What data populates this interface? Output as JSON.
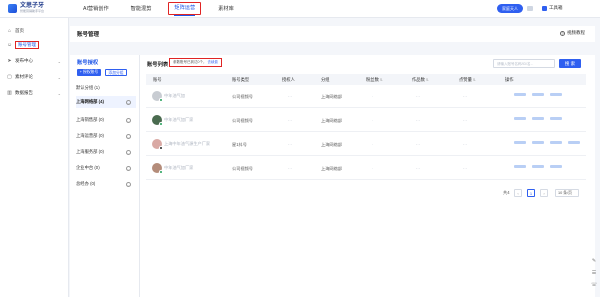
{
  "brand": {
    "name": "文思子牙",
    "tagline": "智能营销助手平台"
  },
  "top_nav": [
    {
      "label": "AI营销创作",
      "active": false
    },
    {
      "label": "智能混剪",
      "active": false
    },
    {
      "label": "矩阵运营",
      "active": true
    },
    {
      "label": "素材库",
      "active": false
    }
  ],
  "header": {
    "user_badge": "家庭天人",
    "workbench_label": "工具箱"
  },
  "sidebar": {
    "items": [
      {
        "label": "首页",
        "icon": "home-icon",
        "active": false,
        "has_chevron": false
      },
      {
        "label": "账号管理",
        "icon": "user-icon",
        "active": true,
        "has_chevron": false
      },
      {
        "label": "发布中心",
        "icon": "send-icon",
        "active": false,
        "has_chevron": true
      },
      {
        "label": "素材评论",
        "icon": "comment-icon",
        "active": false,
        "has_chevron": true
      },
      {
        "label": "数据报告",
        "icon": "chart-icon",
        "active": false,
        "has_chevron": true
      }
    ]
  },
  "page": {
    "title": "账号管理",
    "help_label": "视频教程"
  },
  "groups": {
    "title": "账号授权",
    "add_label": "+ 授权账号",
    "sort_label": "添加分组",
    "items": [
      {
        "label": "默认分组 (1)",
        "selected": false,
        "has_more": false
      },
      {
        "label": "上海网络部 (4)",
        "selected": true,
        "has_more": true
      },
      {
        "label": "上海销售部 (0)",
        "selected": false,
        "has_more": true
      },
      {
        "label": "上海运营部 (0)",
        "selected": false,
        "has_more": true
      },
      {
        "label": "上海服务部 (0)",
        "selected": false,
        "has_more": true
      },
      {
        "label": "企业中台 (0)",
        "selected": false,
        "has_more": true
      },
      {
        "label": "总经办 (0)",
        "selected": false,
        "has_more": true
      }
    ]
  },
  "table": {
    "title": "账号列表",
    "warning_text": "参数账号已到达0个，",
    "warning_link": "去续费",
    "search_placeholder": "请输入账号名称/ID/名...",
    "search_button": "搜 索",
    "columns": [
      "账号",
      "账号类型",
      "授权人",
      "分组",
      "粉丝数",
      "作品数",
      "点赞量",
      "操作"
    ],
    "rows": [
      {
        "account": "中年油气加",
        "type": "公司视频号",
        "authorizer": "- -",
        "group": "上海网络部",
        "fans": "·",
        "works": "- -",
        "likes": "- -"
      },
      {
        "account": "中年油气加厂家",
        "type": "公司视频号",
        "authorizer": "- -",
        "group": "上海网络部",
        "fans": "·",
        "works": "- -",
        "likes": "- -"
      },
      {
        "account": "上海中年油气源生产厂家",
        "type": "星1抖号",
        "authorizer": "- -",
        "group": "上海网络部",
        "fans": "·",
        "works": "- -",
        "likes": "- -"
      },
      {
        "account": "中年油气加厂家",
        "type": "公司视频号",
        "authorizer": "- -",
        "group": "上海网络部",
        "fans": "·",
        "works": "- -",
        "likes": "- -"
      }
    ]
  },
  "pagination": {
    "total": "共4",
    "current": "1",
    "page_size": "10 条/页"
  }
}
